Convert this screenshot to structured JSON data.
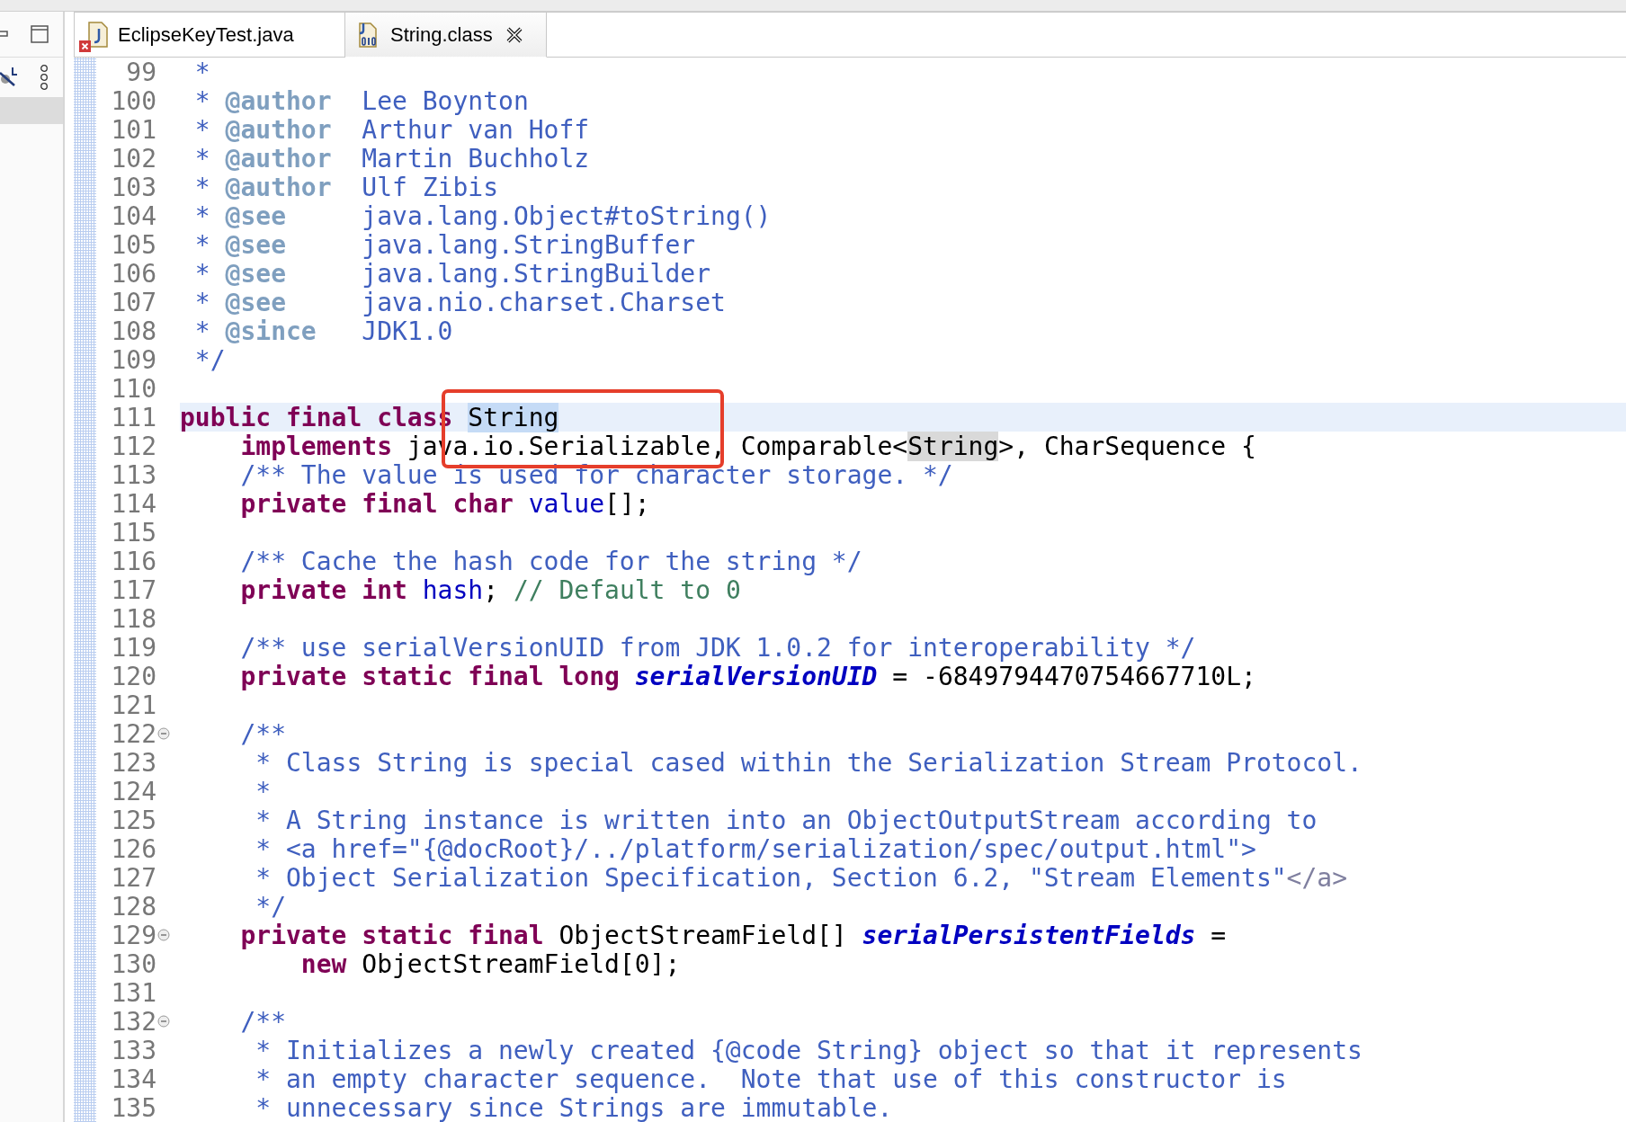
{
  "tabs": [
    {
      "label": "EclipseKeyTest.java",
      "kind": "java",
      "error": true,
      "selected": false
    },
    {
      "label": "String.class",
      "kind": "class",
      "error": false,
      "selected": true
    }
  ],
  "editor": {
    "lines": [
      {
        "number": "99",
        "fold": false,
        "current": false,
        "tokens": [
          {
            "kind": "comment",
            "text": " *"
          }
        ]
      },
      {
        "number": "100",
        "fold": false,
        "current": false,
        "tokens": [
          {
            "kind": "comment",
            "text": " * "
          },
          {
            "kind": "doctag",
            "text": "@author"
          },
          {
            "kind": "comment",
            "text": "  Lee Boynton"
          }
        ]
      },
      {
        "number": "101",
        "fold": false,
        "current": false,
        "tokens": [
          {
            "kind": "comment",
            "text": " * "
          },
          {
            "kind": "doctag",
            "text": "@author"
          },
          {
            "kind": "comment",
            "text": "  Arthur van Hoff"
          }
        ]
      },
      {
        "number": "102",
        "fold": false,
        "current": false,
        "tokens": [
          {
            "kind": "comment",
            "text": " * "
          },
          {
            "kind": "doctag",
            "text": "@author"
          },
          {
            "kind": "comment",
            "text": "  Martin Buchholz"
          }
        ]
      },
      {
        "number": "103",
        "fold": false,
        "current": false,
        "tokens": [
          {
            "kind": "comment",
            "text": " * "
          },
          {
            "kind": "doctag",
            "text": "@author"
          },
          {
            "kind": "comment",
            "text": "  Ulf Zibis"
          }
        ]
      },
      {
        "number": "104",
        "fold": false,
        "current": false,
        "tokens": [
          {
            "kind": "comment",
            "text": " * "
          },
          {
            "kind": "doctag",
            "text": "@see"
          },
          {
            "kind": "comment",
            "text": "     java.lang.Object#toString()"
          }
        ]
      },
      {
        "number": "105",
        "fold": false,
        "current": false,
        "tokens": [
          {
            "kind": "comment",
            "text": " * "
          },
          {
            "kind": "doctag",
            "text": "@see"
          },
          {
            "kind": "comment",
            "text": "     java.lang.StringBuffer"
          }
        ]
      },
      {
        "number": "106",
        "fold": false,
        "current": false,
        "tokens": [
          {
            "kind": "comment",
            "text": " * "
          },
          {
            "kind": "doctag",
            "text": "@see"
          },
          {
            "kind": "comment",
            "text": "     java.lang.StringBuilder"
          }
        ]
      },
      {
        "number": "107",
        "fold": false,
        "current": false,
        "tokens": [
          {
            "kind": "comment",
            "text": " * "
          },
          {
            "kind": "doctag",
            "text": "@see"
          },
          {
            "kind": "comment",
            "text": "     java.nio.charset.Charset"
          }
        ]
      },
      {
        "number": "108",
        "fold": false,
        "current": false,
        "tokens": [
          {
            "kind": "comment",
            "text": " * "
          },
          {
            "kind": "doctag",
            "text": "@since"
          },
          {
            "kind": "comment",
            "text": "   JDK1.0"
          }
        ]
      },
      {
        "number": "109",
        "fold": false,
        "current": false,
        "tokens": [
          {
            "kind": "comment",
            "text": " */"
          }
        ]
      },
      {
        "number": "110",
        "fold": false,
        "current": false
      },
      {
        "number": "111",
        "fold": false,
        "current": true,
        "tokens": [
          {
            "kind": "keyword",
            "text": "public final class "
          },
          {
            "kind": "selection",
            "text": "String"
          }
        ]
      },
      {
        "number": "112",
        "fold": false,
        "current": false,
        "tokens": [
          {
            "kind": "keyword",
            "text": "    implements"
          },
          {
            "kind": "plain",
            "text": " java.io.Serializable, Comparable<"
          },
          {
            "kind": "occurrence",
            "text": "String"
          },
          {
            "kind": "plain",
            "text": ">, CharSequence {"
          }
        ]
      },
      {
        "number": "113",
        "fold": false,
        "current": false,
        "tokens": [
          {
            "kind": "comment",
            "text": "    /** The value is used for character storage. */"
          }
        ]
      },
      {
        "number": "114",
        "fold": false,
        "current": false,
        "tokens": [
          {
            "kind": "keyword",
            "text": "    private final char "
          },
          {
            "kind": "field",
            "text": "value"
          },
          {
            "kind": "plain",
            "text": "[];"
          }
        ]
      },
      {
        "number": "115",
        "fold": false,
        "current": false
      },
      {
        "number": "116",
        "fold": false,
        "current": false,
        "tokens": [
          {
            "kind": "comment",
            "text": "    /** Cache the hash code for the string */"
          }
        ]
      },
      {
        "number": "117",
        "fold": false,
        "current": false,
        "tokens": [
          {
            "kind": "keyword",
            "text": "    private int "
          },
          {
            "kind": "field",
            "text": "hash"
          },
          {
            "kind": "plain",
            "text": "; "
          },
          {
            "kind": "line-comment",
            "text": "// Default to 0"
          }
        ]
      },
      {
        "number": "118",
        "fold": false,
        "current": false
      },
      {
        "number": "119",
        "fold": false,
        "current": false,
        "tokens": [
          {
            "kind": "comment",
            "text": "    /** use serialVersionUID from JDK 1.0.2 for interoperability */"
          }
        ]
      },
      {
        "number": "120",
        "fold": false,
        "current": false,
        "tokens": [
          {
            "kind": "keyword",
            "text": "    private static final long "
          },
          {
            "kind": "static-field",
            "text": "serialVersionUID"
          },
          {
            "kind": "plain",
            "text": " = -6849794470754667710L;"
          }
        ]
      },
      {
        "number": "121",
        "fold": false,
        "current": false
      },
      {
        "number": "122",
        "fold": true,
        "current": false,
        "tokens": [
          {
            "kind": "comment",
            "text": "    /**"
          }
        ]
      },
      {
        "number": "123",
        "fold": false,
        "current": false,
        "tokens": [
          {
            "kind": "comment",
            "text": "     * Class String is special cased within the Serialization Stream Protocol."
          }
        ]
      },
      {
        "number": "124",
        "fold": false,
        "current": false,
        "tokens": [
          {
            "kind": "comment",
            "text": "     *"
          }
        ]
      },
      {
        "number": "125",
        "fold": false,
        "current": false,
        "tokens": [
          {
            "kind": "comment",
            "text": "     * A String instance is written into an ObjectOutputStream according to"
          }
        ]
      },
      {
        "number": "126",
        "fold": false,
        "current": false,
        "tokens": [
          {
            "kind": "comment",
            "text": "     * <a href=\"{@docRoot}/../platform/serialization/spec/output.html\">"
          }
        ]
      },
      {
        "number": "127",
        "fold": false,
        "current": false,
        "tokens": [
          {
            "kind": "comment",
            "text": "     * Object Serialization Specification, Section 6.2, \"Stream Elements\""
          },
          {
            "kind": "html-tag",
            "text": "</a>"
          }
        ]
      },
      {
        "number": "128",
        "fold": false,
        "current": false,
        "tokens": [
          {
            "kind": "comment",
            "text": "     */"
          }
        ]
      },
      {
        "number": "129",
        "fold": true,
        "current": false,
        "tokens": [
          {
            "kind": "keyword",
            "text": "    private static final"
          },
          {
            "kind": "plain",
            "text": " ObjectStreamField[] "
          },
          {
            "kind": "static-field",
            "text": "serialPersistentFields"
          },
          {
            "kind": "plain",
            "text": " ="
          }
        ]
      },
      {
        "number": "130",
        "fold": false,
        "current": false,
        "tokens": [
          {
            "kind": "keyword",
            "text": "        new"
          },
          {
            "kind": "plain",
            "text": " ObjectStreamField[0];"
          }
        ]
      },
      {
        "number": "131",
        "fold": false,
        "current": false
      },
      {
        "number": "132",
        "fold": true,
        "current": false,
        "tokens": [
          {
            "kind": "comment",
            "text": "    /**"
          }
        ]
      },
      {
        "number": "133",
        "fold": false,
        "current": false,
        "tokens": [
          {
            "kind": "comment",
            "text": "     * Initializes a newly created {@code String} object so that it represents"
          }
        ]
      },
      {
        "number": "134",
        "fold": false,
        "current": false,
        "tokens": [
          {
            "kind": "comment",
            "text": "     * an empty character sequence.  Note that use of this constructor is"
          }
        ]
      },
      {
        "number": "135",
        "fold": false,
        "current": false,
        "tokens": [
          {
            "kind": "comment",
            "text": "     * unnecessary since Strings are immutable."
          }
        ]
      }
    ]
  }
}
